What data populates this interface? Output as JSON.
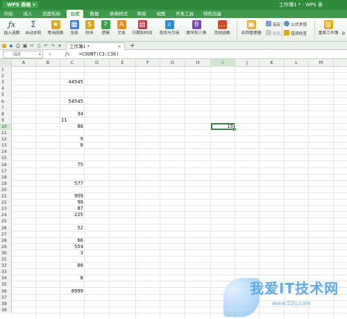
{
  "window": {
    "brand": "WPS 表格",
    "brand_dropdown": "▾",
    "doc_title": "工作簿1 * - WPS 表"
  },
  "menu": [
    {
      "label": "开始"
    },
    {
      "label": "插入"
    },
    {
      "label": "页面布局"
    },
    {
      "label": "公式",
      "active": true
    },
    {
      "label": "数据"
    },
    {
      "label": "表格样式"
    },
    {
      "label": "审阅"
    },
    {
      "label": "视图"
    },
    {
      "label": "开发工具"
    },
    {
      "label": "特色功能"
    }
  ],
  "ribbon": {
    "insert_function": "插入函数",
    "autosum": "自动求和",
    "common": "常用函数",
    "all": "全部",
    "finance": "财务",
    "logic": "逻辑",
    "text": "文本",
    "datetime": "日期和时间",
    "lookup": "查找与引用",
    "math": "数学和三角",
    "other": "其他函数",
    "name_manager": "名称管理器",
    "specify": "指定",
    "paste": "粘贴",
    "formula_eval": "公式求值",
    "error_check": "错误检查",
    "recalc": "重算工作簿",
    "calc_cut": "计"
  },
  "toolbar": {
    "doc_tab": "工作簿1 *",
    "close": "×",
    "add": "+"
  },
  "formula_bar": {
    "name_box": "I10",
    "fx": "fx",
    "formula": "=COUNT(C3:C36)"
  },
  "columns": [
    "A",
    "B",
    "C",
    "D",
    "E",
    "F",
    "G",
    "H",
    "I",
    "J",
    "K",
    "L",
    "M"
  ],
  "rows": [
    "1",
    "2",
    "3",
    "4",
    "5",
    "6",
    "7",
    "8",
    "9",
    "10",
    "11",
    "12",
    "13",
    "14",
    "15",
    "16",
    "17",
    "18",
    "19",
    "20",
    "21",
    "22",
    "23",
    "24",
    "25",
    "26",
    "27",
    "28",
    "29",
    "30",
    "31",
    "32",
    "33",
    "34",
    "35",
    "36",
    "37",
    "38",
    "39"
  ],
  "cells_c": {
    "3": "44545",
    "6": "54545",
    "8": "34",
    "10": "88",
    "12": "9",
    "13": "8",
    "16": "75",
    "19": "577",
    "21": "909",
    "22": "98",
    "23": "87",
    "24": "225",
    "26": "52",
    "28": "66",
    "29": "554",
    "30": "3",
    "32": "88",
    "34": "8",
    "36": "8999"
  },
  "cells_b": {
    "9": "11"
  },
  "active_cell": {
    "ref": "I10",
    "value": "19"
  },
  "watermark": {
    "text": "我爱IT技术网",
    "url": "www.52ij.com"
  },
  "colors": {
    "wps_green": "#2f8a3c",
    "selection": "#2a8a3a"
  }
}
